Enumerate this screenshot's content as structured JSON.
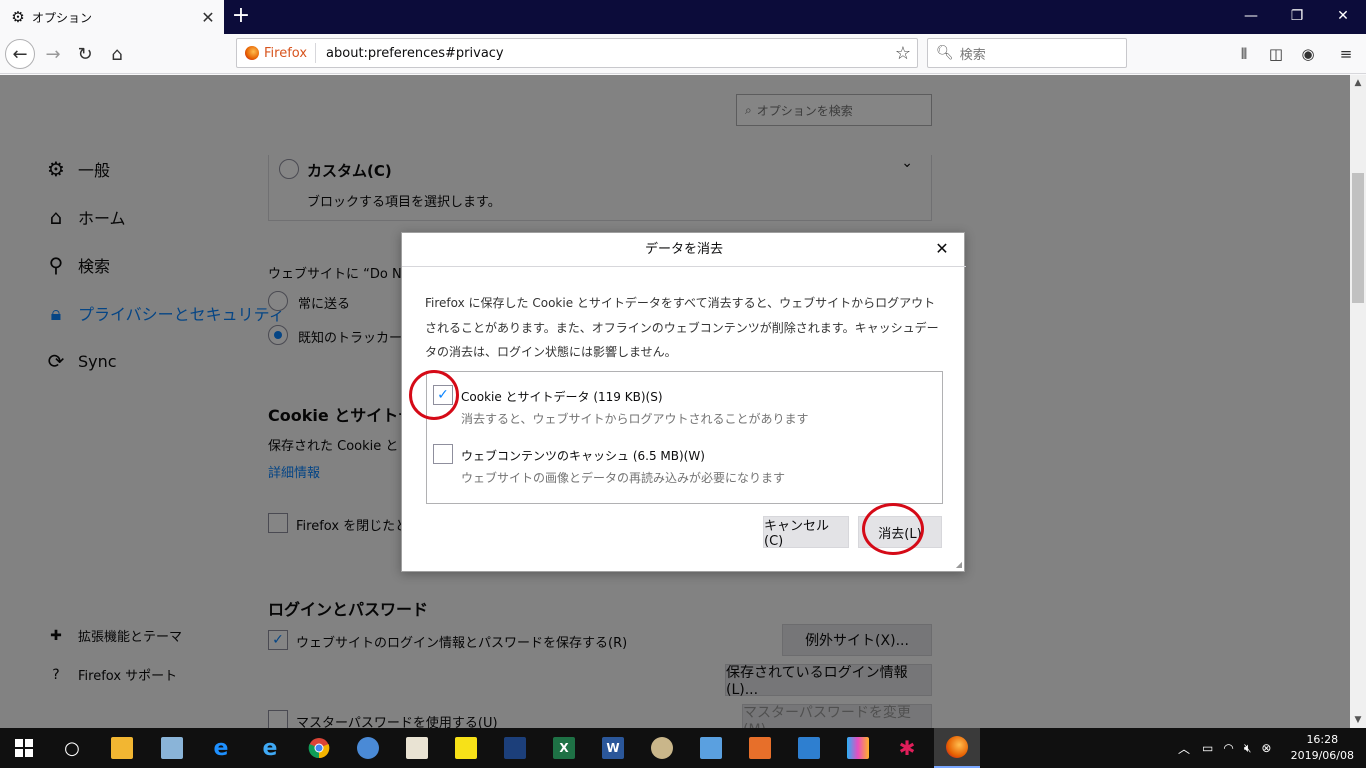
{
  "browser": {
    "tab_title": "オプション",
    "new_tab": "+",
    "window_controls": {
      "minimize": "—",
      "restore": "❐",
      "close": "✕"
    },
    "identity_label": "Firefox",
    "url": "about:preferences#privacy",
    "search_placeholder": "検索"
  },
  "prefs": {
    "search_options_placeholder": "オプションを検索",
    "categories": [
      {
        "label": "一般",
        "icon": "gear-icon"
      },
      {
        "label": "ホーム",
        "icon": "home-icon"
      },
      {
        "label": "検索",
        "icon": "search-icon"
      },
      {
        "label": "プライバシーとセキュリティ",
        "icon": "lock-icon"
      },
      {
        "label": "Sync",
        "icon": "sync-icon"
      }
    ],
    "footer_links": [
      {
        "label": "拡張機能とテーマ",
        "icon": "puzzle-icon"
      },
      {
        "label": "Firefox サポート",
        "icon": "help-icon"
      }
    ],
    "custom_label": "カスタム(C)",
    "custom_desc": "ブロックする項目を選択します。",
    "dnt_label": "ウェブサイトに “Do Not",
    "dnt_always": "常に送る",
    "dnt_trackers": "既知のトラッカーを",
    "cookie_heading": "Cookie とサイトデー",
    "cookie_desc": "保存された Cookie と",
    "learn_more": "詳細情報",
    "close_firefox_label": "Firefox を閉じたと",
    "login_heading": "ログインとパスワード",
    "save_logins_label": "ウェブサイトのログイン情報とパスワードを保存する(R)",
    "exceptions_button": "例外サイト(X)...",
    "saved_logins_button": "保存されているログイン情報(L)...",
    "master_password_label": "マスターパスワードを使用する(U)",
    "change_master_button": "マスターパスワードを変更(M)..."
  },
  "dialog": {
    "title": "データを消去",
    "description": "Firefox に保存した Cookie とサイトデータをすべて消去すると、ウェブサイトからログアウトされることがあります。また、オフラインのウェブコンテンツが削除されます。キャッシュデータの消去は、ログイン状態には影響しません。",
    "items": [
      {
        "label": "Cookie とサイトデータ (119 KB)(S)",
        "sub": "消去すると、ウェブサイトからログアウトされることがあります",
        "checked": true
      },
      {
        "label": "ウェブコンテンツのキャッシュ (6.5 MB)(W)",
        "sub": "ウェブサイトの画像とデータの再読み込みが必要になります",
        "checked": false
      }
    ],
    "cancel_button": "キャンセル(C)",
    "clear_button": "消去(L)"
  },
  "taskbar": {
    "time": "16:28",
    "date": "2019/06/08"
  }
}
